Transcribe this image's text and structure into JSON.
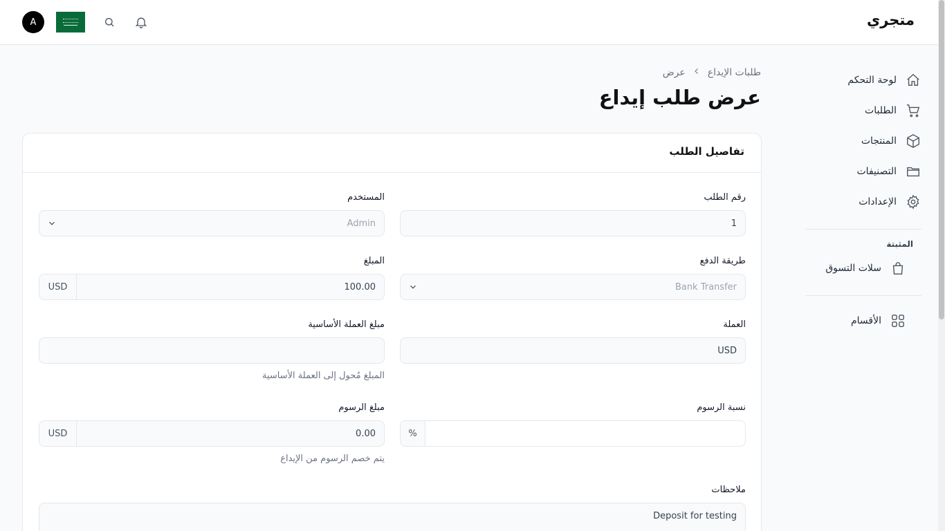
{
  "header": {
    "brand": "متجري",
    "avatar_initial": "A",
    "flag_icon": "saudi-flag-icon",
    "search_icon": "search-icon",
    "bell_icon": "bell-icon"
  },
  "sidebar": {
    "items": [
      {
        "label": "لوحة التحكم",
        "icon": "home-icon"
      },
      {
        "label": "الطلبات",
        "icon": "cart-icon"
      },
      {
        "label": "المنتجات",
        "icon": "box-icon"
      },
      {
        "label": "التصنيفات",
        "icon": "folder-icon"
      },
      {
        "label": "الإعدادات",
        "icon": "gear-icon"
      }
    ],
    "group_label": "المثبتة",
    "pinned": [
      {
        "label": "سلات التسوق",
        "icon": "shopping-bag-icon"
      }
    ],
    "sections": [
      {
        "label": "الأقسام",
        "icon": "grid-icon"
      }
    ]
  },
  "breadcrumb": {
    "parent": "طلبات الإيداع",
    "current": "عرض"
  },
  "page": {
    "title": "عرض طلب إيداع"
  },
  "card": {
    "title": "تفاصيل الطلب",
    "fields": {
      "order_number": {
        "label": "رقم الطلب",
        "value": "1"
      },
      "user": {
        "label": "المستخدم",
        "value": "Admin"
      },
      "payment_method": {
        "label": "طريقة الدفع",
        "value": "Bank Transfer"
      },
      "amount": {
        "label": "المبلغ",
        "value": "100.00",
        "addon": "USD"
      },
      "currency": {
        "label": "العملة",
        "value": "USD"
      },
      "base_amount": {
        "label": "مبلغ العملة الأساسية",
        "value": "",
        "help": "المبلغ مُحول إلى العملة الأساسية"
      },
      "fee_rate": {
        "label": "نسبة الرسوم",
        "value": "",
        "addon": "%"
      },
      "fee_amount": {
        "label": "مبلغ الرسوم",
        "value": "0.00",
        "addon": "USD",
        "help": "يتم خصم الرسوم من الإيداع"
      },
      "notes": {
        "label": "ملاحظات",
        "value": "Deposit for testing"
      }
    }
  },
  "colors": {
    "accent": "#000000",
    "border": "#e5e7eb",
    "flag_green": "#0a6b3a"
  }
}
